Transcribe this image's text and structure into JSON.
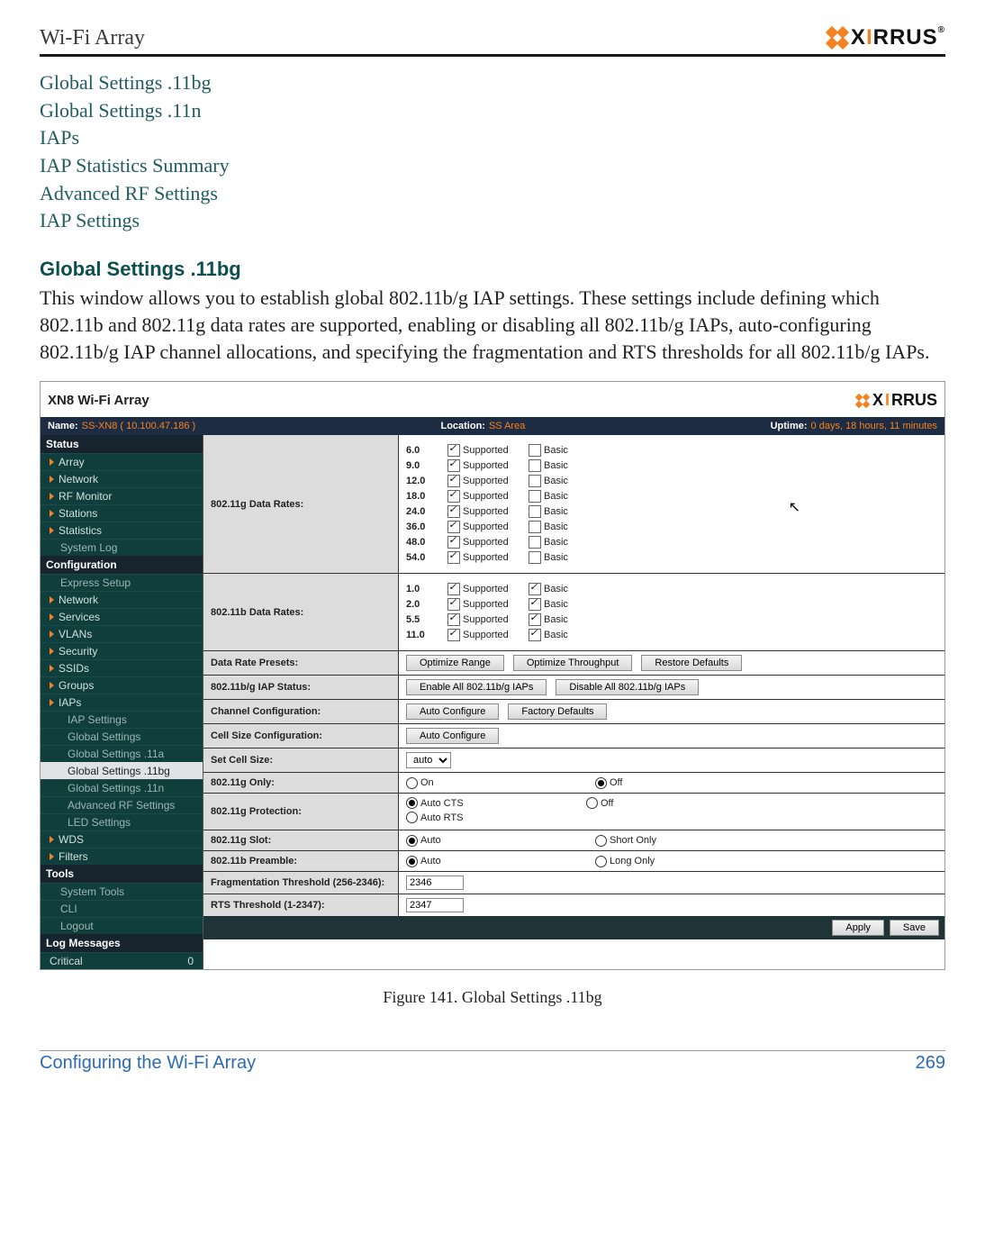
{
  "header": {
    "title": "Wi-Fi Array",
    "logo_text_pre": "X",
    "logo_text_i": "I",
    "logo_text_post": "RRUS"
  },
  "links": [
    "Global Settings .11bg",
    "Global Settings .11n",
    "IAPs",
    "IAP Statistics Summary",
    "Advanced RF Settings",
    "IAP Settings"
  ],
  "section_heading": "Global Settings .11bg",
  "body_text": "This window allows you to establish global 802.11b/g IAP settings. These settings include defining which 802.11b and 802.11g data rates are supported, enabling or disabling all 802.11b/g IAPs, auto-configuring 802.11b/g IAP channel allocations, and specifying the fragmentation and RTS thresholds for all 802.11b/g IAPs.",
  "screenshot": {
    "product": "XN8 Wi-Fi Array",
    "brand_pre": "X",
    "brand_i": "I",
    "brand_post": "RRUS",
    "topbar": {
      "name_label": "Name:",
      "name": "SS-XN8   ( 10.100.47.186 )",
      "loc_label": "Location:",
      "loc": "SS Area",
      "up_label": "Uptime:",
      "up": "0 days, 18 hours, 11 minutes"
    },
    "side": {
      "status": "Status",
      "status_items": [
        "Array",
        "Network",
        "RF Monitor",
        "Stations",
        "Statistics"
      ],
      "syslog": "System Log",
      "config": "Configuration",
      "express": "Express Setup",
      "config_items": [
        "Network",
        "Services",
        "VLANs",
        "Security",
        "SSIDs",
        "Groups",
        "IAPs"
      ],
      "iap_subs": [
        "IAP Settings",
        "Global Settings",
        "Global Settings .11a",
        "Global Settings .11bg",
        "Global Settings .11n",
        "Advanced RF Settings",
        "LED Settings"
      ],
      "wds": "WDS",
      "filters": "Filters",
      "tools": "Tools",
      "tools_items": [
        "System Tools",
        "CLI",
        "Logout"
      ],
      "log": "Log Messages",
      "critical": "Critical",
      "critical_n": "0"
    },
    "settings": {
      "g_label": "802.11g Data Rates:",
      "g_rates": [
        "6.0",
        "9.0",
        "12.0",
        "18.0",
        "24.0",
        "36.0",
        "48.0",
        "54.0"
      ],
      "g_supported": [
        true,
        true,
        true,
        true,
        true,
        true,
        true,
        true
      ],
      "g_basic": [
        false,
        false,
        false,
        false,
        false,
        false,
        false,
        false
      ],
      "b_label": "802.11b Data Rates:",
      "b_rates": [
        "1.0",
        "2.0",
        "5.5",
        "11.0"
      ],
      "b_supported": [
        true,
        true,
        true,
        true
      ],
      "b_basic": [
        true,
        true,
        true,
        true
      ],
      "supported_lbl": "Supported",
      "basic_lbl": "Basic",
      "presets_label": "Data Rate Presets:",
      "btn_range": "Optimize Range",
      "btn_tput": "Optimize Throughput",
      "btn_restore": "Restore Defaults",
      "iap_status_label": "802.11b/g IAP Status:",
      "btn_enable": "Enable All 802.11b/g IAPs",
      "btn_disable": "Disable All 802.11b/g IAPs",
      "chan_label": "Channel Configuration:",
      "btn_auto": "Auto Configure",
      "btn_factory": "Factory Defaults",
      "cell_cfg_label": "Cell Size Configuration:",
      "btn_auto2": "Auto Configure",
      "cell_size_label": "Set Cell Size:",
      "cell_size_val": "auto",
      "g_only_label": "802.11g Only:",
      "on": "On",
      "off": "Off",
      "g_prot_label": "802.11g Protection:",
      "auto_cts": "Auto CTS",
      "auto_rts": "Auto RTS",
      "g_slot_label": "802.11g Slot:",
      "auto": "Auto",
      "short_only": "Short Only",
      "b_pre_label": "802.11b Preamble:",
      "long_only": "Long Only",
      "frag_label": "Fragmentation Threshold (256-2346):",
      "frag_val": "2346",
      "rts_label": "RTS Threshold (1-2347):",
      "rts_val": "2347",
      "apply": "Apply",
      "save": "Save"
    }
  },
  "caption": "Figure 141. Global Settings .11bg",
  "footer_left": "Configuring the Wi-Fi Array",
  "footer_right": "269"
}
